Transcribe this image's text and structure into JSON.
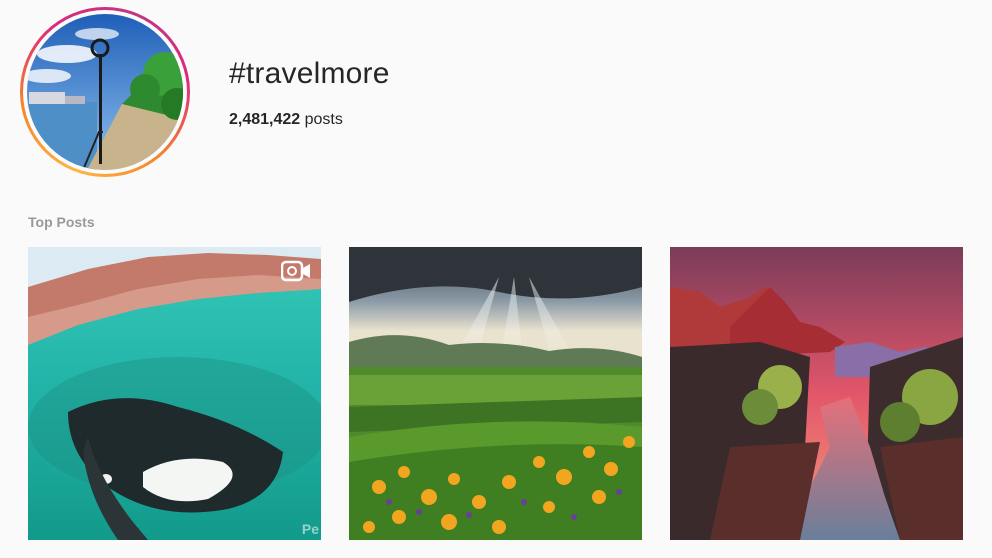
{
  "header": {
    "hashtag": "#travelmore",
    "post_count_value": "2,481,422",
    "post_count_suffix": " posts"
  },
  "top_posts": {
    "label": "Top Posts",
    "posts": [
      {
        "name": "orca-underwater-video",
        "is_video": true,
        "watermark": "Pe"
      },
      {
        "name": "mountain-valley-wildflowers",
        "is_video": false
      },
      {
        "name": "red-canyon-river-sunset",
        "is_video": false
      }
    ]
  },
  "colors": {
    "ring_gradient": [
      "#fdb642",
      "#f58529",
      "#dd2a7b",
      "#c13584"
    ],
    "secondary_text": "#999999",
    "primary_text": "#262626"
  }
}
